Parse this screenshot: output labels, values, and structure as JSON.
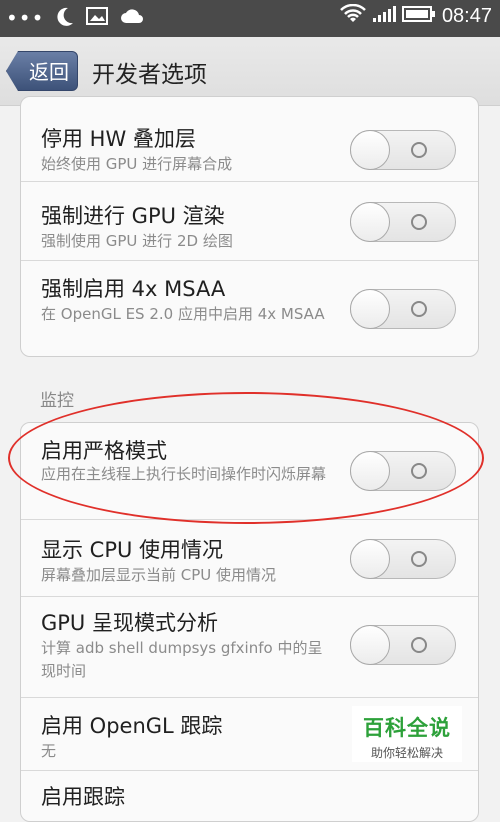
{
  "status_bar": {
    "time": "08:47",
    "dots": "•••"
  },
  "header": {
    "back_label": "返回",
    "title": "开发者选项"
  },
  "section_monitor": "监控",
  "rendering_items": [
    {
      "title": "停用 HW 叠加层",
      "subtitle": "始终使用 GPU 进行屏幕合成",
      "enabled": false
    },
    {
      "title": "强制进行 GPU 渲染",
      "subtitle": "强制使用 GPU 进行 2D 绘图",
      "enabled": false
    },
    {
      "title": "强制启用 4x MSAA",
      "subtitle": "在 OpenGL ES 2.0 应用中启用 4x MSAA",
      "enabled": false
    }
  ],
  "monitor_items": [
    {
      "title": "启用严格模式",
      "subtitle": "应用在主线程上执行长时间操作时闪烁屏幕",
      "enabled": false
    },
    {
      "title": "显示 CPU 使用情况",
      "subtitle": "屏幕叠加层显示当前 CPU 使用情况",
      "enabled": false
    },
    {
      "title": "GPU 呈现模式分析",
      "subtitle": "计算 adb shell dumpsys gfxinfo 中的呈现时间",
      "enabled": false
    },
    {
      "title": "启用 OpenGL 跟踪",
      "subtitle": "无"
    },
    {
      "title": "启用跟踪"
    }
  ],
  "watermark": {
    "main": "百科全说",
    "sub": "助你轻松解决"
  },
  "colors": {
    "highlight": "#e0302a",
    "back_button": "#4a5f88",
    "status_bar": "#4a4a4a"
  }
}
